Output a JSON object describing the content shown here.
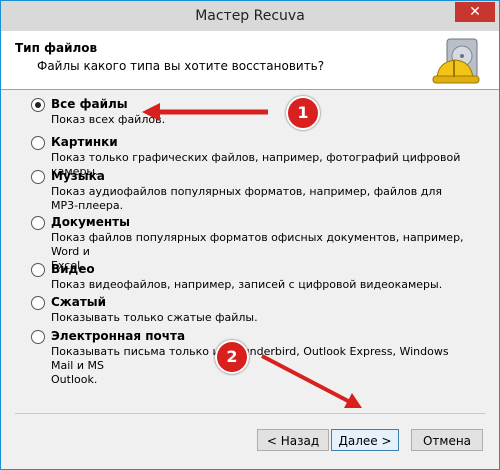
{
  "window": {
    "title": "Мастер Recuva",
    "close_glyph": "✕"
  },
  "header": {
    "title": "Тип файлов",
    "subtitle": "Файлы какого типа вы хотите восстановить?"
  },
  "options": [
    {
      "title": "Все файлы",
      "desc": "Показ всех файлов.",
      "checked": true
    },
    {
      "title": "Картинки",
      "desc": "Показ только графических файлов, например, фотографий цифровой камеры."
    },
    {
      "title": "Музыка",
      "desc": "Показ аудиофайлов популярных форматов, например, файлов для",
      "desc2": "MP3-плеера."
    },
    {
      "title": "Документы",
      "desc": "Показ файлов популярных форматов офисных документов, например, Word и",
      "desc2": "Excel."
    },
    {
      "title": "Видео",
      "desc": "Показ видеофайлов, например, записей с цифровой видеокамеры."
    },
    {
      "title": "Сжатый",
      "desc": "Показывать только сжатые файлы."
    },
    {
      "title": "Электронная почта",
      "desc": "Показывать письма только из Thunderbird, Outlook Express, Windows Mail и MS",
      "desc2": "Outlook."
    }
  ],
  "buttons": {
    "back": "< Назад",
    "next": "Далее >",
    "cancel": "Отмена"
  },
  "annotations": [
    {
      "label": "1"
    },
    {
      "label": "2"
    }
  ],
  "colors": {
    "annotation": "#d8201e",
    "title_bar": "#d9d9d9",
    "close": "#c7372f"
  },
  "icons": {
    "logo": "recuva-drive-helmet-icon",
    "close": "close-icon"
  }
}
